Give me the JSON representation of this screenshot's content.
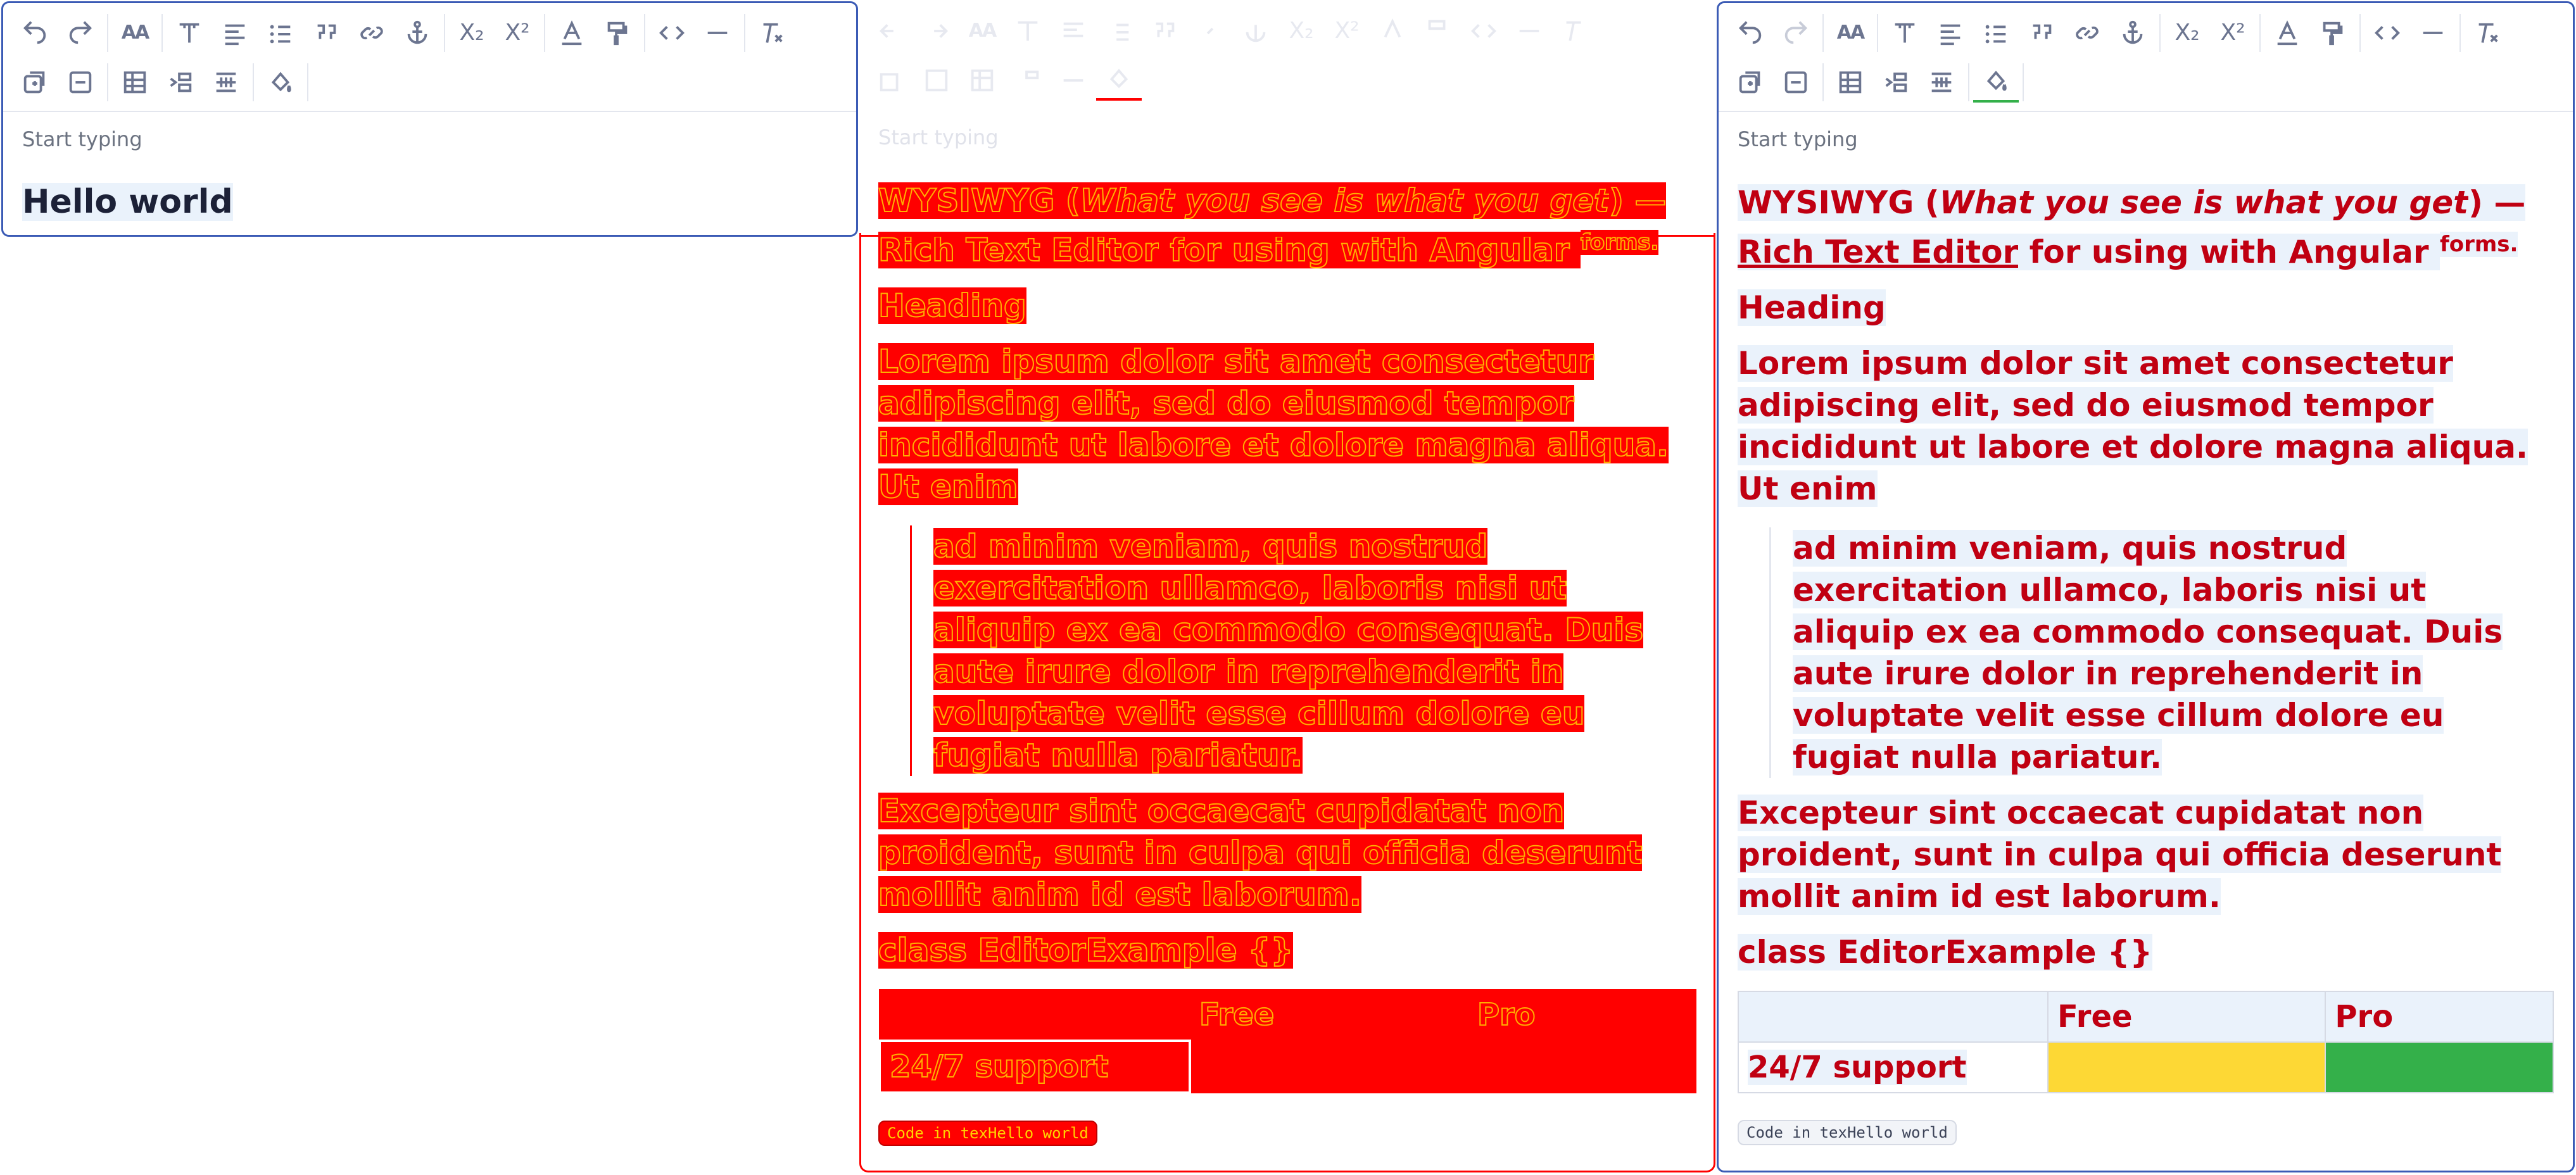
{
  "toolbar": {
    "row1": [
      "undo-icon",
      "redo-icon",
      "font-size-icon",
      "heading-icon",
      "align-icon",
      "bullet-list-icon",
      "blockquote-icon",
      "link-icon",
      "anchor-icon",
      "subscript-icon",
      "superscript-icon",
      "text-color-icon",
      "background-color-icon",
      "code-icon",
      "horizontal-rule-icon",
      "clear-format-icon"
    ],
    "row2": [
      "insert-row-icon",
      "delete-row-icon",
      "table-icon",
      "merge-cells-icon",
      "split-cells-icon",
      "cell-color-icon"
    ],
    "labels": {
      "font_size": "AA",
      "subscript": "X₂",
      "superscript": "X²",
      "code": "<>",
      "clear": "Tx"
    }
  },
  "placeholder": "Start typing",
  "editor1": {
    "text": "Hello world"
  },
  "doc": {
    "p1_a": "WYSIWYG (",
    "p1_b": "What you see is what you get",
    "p1_c": ") — ",
    "p1_d": "Rich Text Editor",
    "p1_e": " for using with Angular ",
    "p1_f": "forms.",
    "heading": "Heading",
    "p2": "Lorem ipsum dolor sit amet consectetur adipiscing elit, sed do eiusmod tempor incididunt ut labore et dolore magna aliqua. Ut enim",
    "quote": "ad minim veniam, quis nostrud exercitation ullamco, laboris nisi ut aliquip ex ea commodo consequat. Duis aute irure dolor in reprehenderit in voluptate velit esse cillum dolore eu fugiat nulla pariatur.",
    "p3": "Excepteur sint occaecat cupidatat non proident, sunt in culpa qui officia deserunt mollit anim id est laborum.",
    "code_line": "class EditorExample {}",
    "table": {
      "headers": [
        "",
        "Free",
        "Pro"
      ],
      "row1": [
        "24/7 support",
        "",
        ""
      ],
      "colors": {
        "free": "#fdd835",
        "pro": "#34b04a"
      }
    },
    "inline_code": "Code in texHello world"
  },
  "colors": {
    "accent": "#3b5bb5",
    "text_red": "#c00012",
    "overlay_red": "#ff0000"
  }
}
